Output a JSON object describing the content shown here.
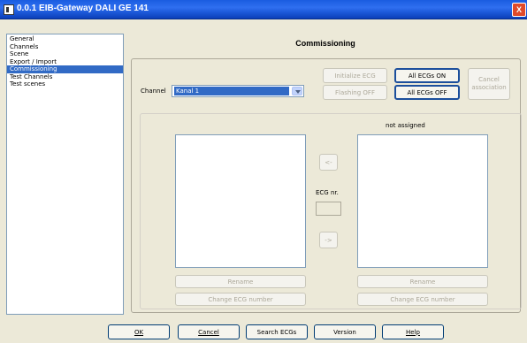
{
  "window": {
    "title": "0.0.1  EIB-Gateway DALI GE 141",
    "close_glyph": "X"
  },
  "sidebar": {
    "items": [
      {
        "label": "General",
        "selected": false
      },
      {
        "label": "Channels",
        "selected": false
      },
      {
        "label": "Scene",
        "selected": false
      },
      {
        "label": "Export / Import",
        "selected": false
      },
      {
        "label": "Commissioning",
        "selected": true
      },
      {
        "label": "Test Channels",
        "selected": false
      },
      {
        "label": "Test scenes",
        "selected": false
      }
    ]
  },
  "panel": {
    "title": "Commissioning",
    "channel_label": "Channel",
    "channel_value": "Kanal 1",
    "initialize_ecg": "Initialize ECG",
    "flashing_off": "Flashing OFF",
    "all_ecgs_on": "All ECGs ON",
    "all_ecgs_off": "All ECGs OFF",
    "cancel_association": "Cancel association",
    "not_assigned_label": "not assigned",
    "move_left": "<-",
    "move_right": "->",
    "ecg_nr_label": "ECG nr.",
    "left_rename": "Rename",
    "left_change_number": "Change ECG number",
    "right_rename": "Rename",
    "right_change_number": "Change ECG number"
  },
  "footer": {
    "ok": "OK",
    "cancel": "Cancel",
    "search_ecgs": "Search ECGs",
    "version": "Version",
    "help": "Help"
  },
  "colors": {
    "titlebar": "#1a5ce0",
    "selection": "#316ac5",
    "dialog_bg": "#ece9d8"
  }
}
